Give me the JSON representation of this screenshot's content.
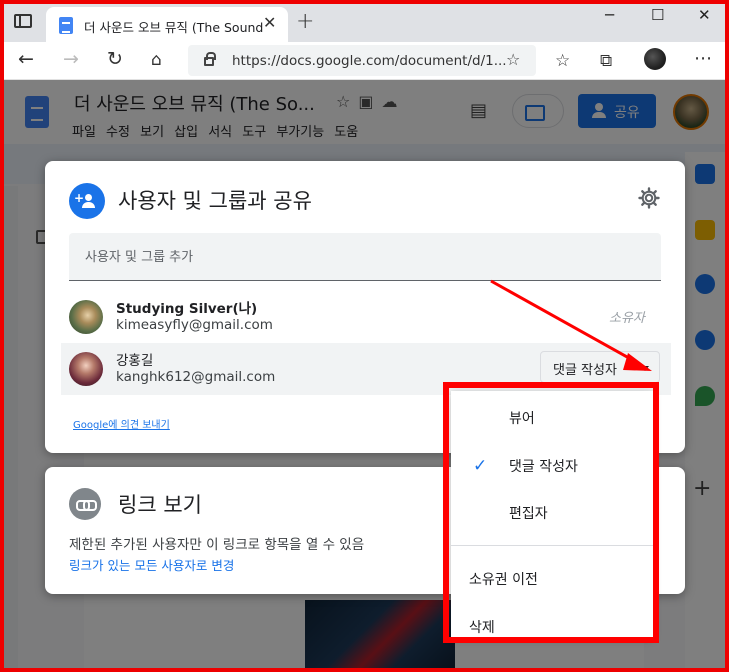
{
  "browser": {
    "tab_title": "더 사운드 오브 뮤직 (The Sound",
    "tab_close": "✕",
    "new_tab": "+",
    "window_controls": [
      "─",
      "☐",
      "✕"
    ],
    "url": "https://docs.google.com/document/d/1...",
    "more_menu": "⋯"
  },
  "docs": {
    "title": "더 사운드 오브 뮤직 (The So...",
    "menu_items": "파일 수정 보기 삽입 서식 도구 부가기능 도움",
    "share_button": "공유"
  },
  "share_dialog": {
    "title": "사용자 및 그룹과 공유",
    "add_placeholder": "사용자 및 그룹 추가",
    "people": [
      {
        "name": "Studying Silver(나)",
        "email": "kimeasyfly@gmail.com",
        "role": "소유자"
      },
      {
        "name": "강홍길",
        "email": "kanghk612@gmail.com",
        "role": "댓글 작성자"
      }
    ],
    "feedback_link": "Google에 의견 보내기"
  },
  "link_card": {
    "title": "링크 보기",
    "description": "제한된 추가된 사용자만 이 링크로 항목을 열 수 있음",
    "change_link": "링크가 있는 모든 사용자로 변경"
  },
  "role_menu": {
    "items": [
      "뷰어",
      "댓글 작성자",
      "편집자"
    ],
    "selected_index": 1,
    "actions": [
      "소유권 이전",
      "삭제"
    ]
  },
  "colors": {
    "accent_blue": "#1a73e8",
    "annotation_red": "#ff0000"
  }
}
